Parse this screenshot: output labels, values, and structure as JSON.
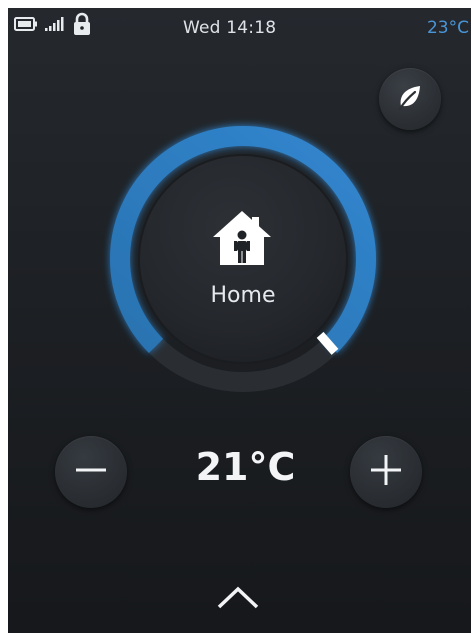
{
  "status_bar": {
    "icons": [
      "battery-icon",
      "signal-icon",
      "lock-icon"
    ],
    "datetime": "Wed 14:18",
    "outdoor_temperature": "23°C"
  },
  "eco_button": {
    "icon": "leaf-icon"
  },
  "dial": {
    "mode_icon": "home-person-icon",
    "mode_label": "Home"
  },
  "setpoint": {
    "value": "21°C",
    "decrease_icon": "minus-icon",
    "increase_icon": "plus-icon"
  },
  "menu": {
    "icon": "chevron-up-icon"
  },
  "colors": {
    "accent": "#2f7fc4",
    "outdoor_temperature": "#4a95d6",
    "background": "#1d2024",
    "text": "#e6e9ed"
  }
}
